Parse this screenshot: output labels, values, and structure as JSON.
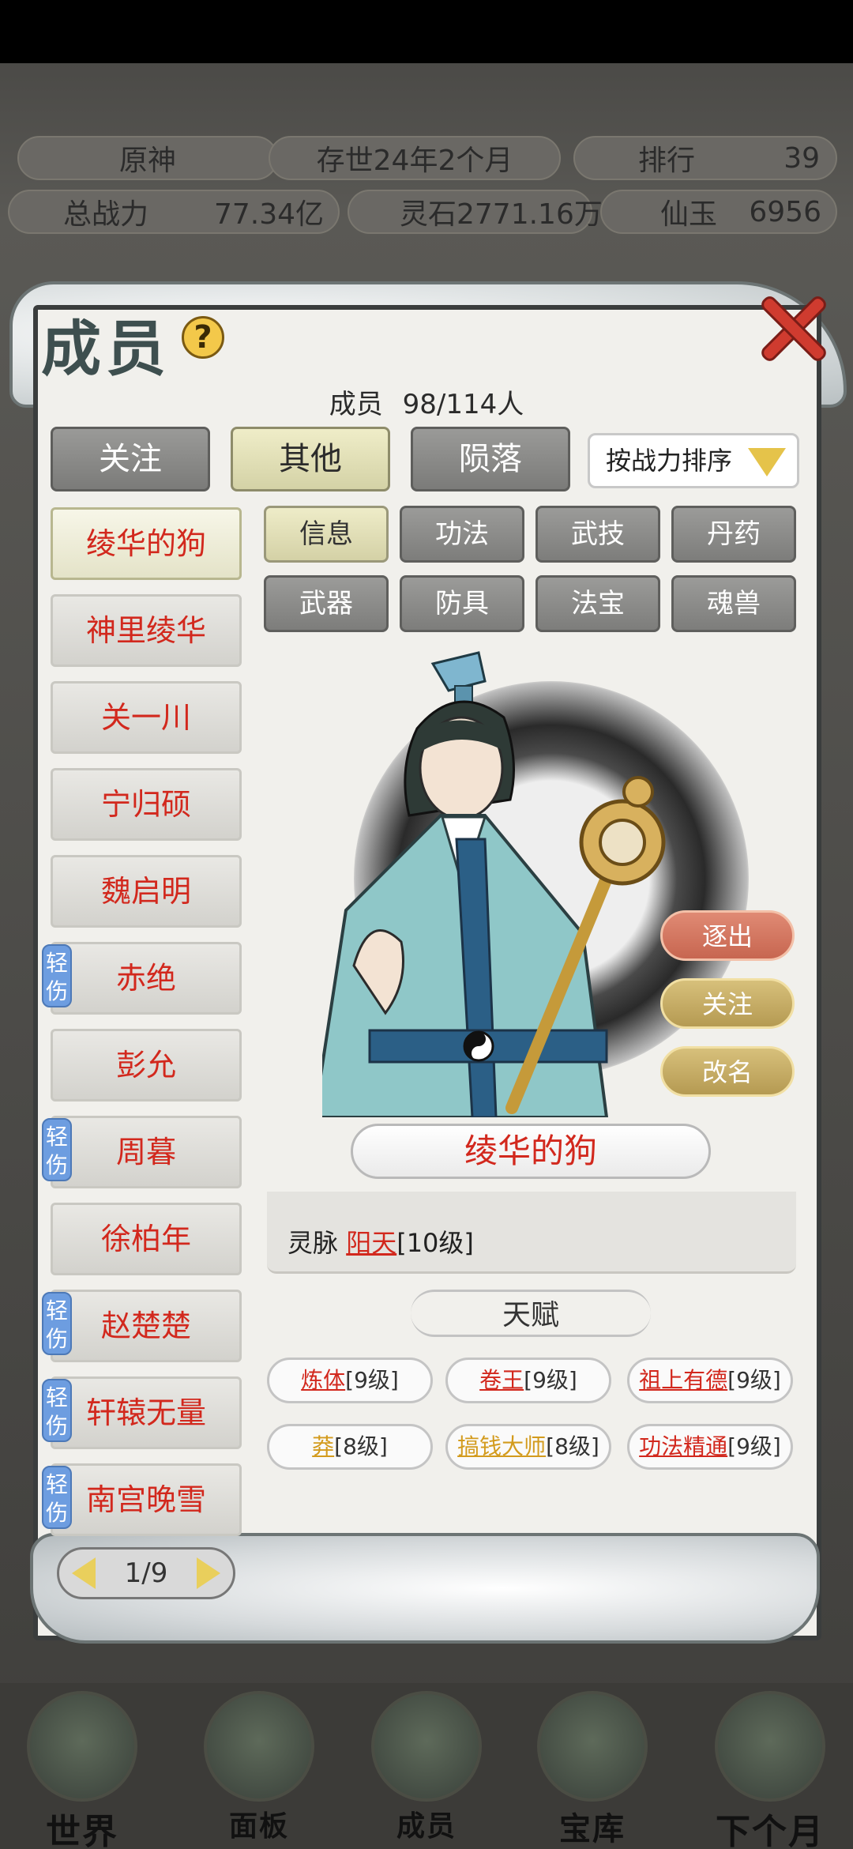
{
  "hud": {
    "server": "原神",
    "age": "存世24年2个月",
    "rank_label": "排行",
    "rank_value": "39",
    "power_label": "总战力",
    "power_value": "77.34亿",
    "spirit_stone": "灵石2771.16万",
    "jade_label": "仙玉",
    "jade_value": "6956"
  },
  "nav": [
    "世界",
    "面板",
    "成员",
    "宝库",
    "下个月"
  ],
  "modal": {
    "title": "成员",
    "count_label": "成员",
    "count_value": "98/114人",
    "tabs": [
      "关注",
      "其他",
      "陨落"
    ],
    "active_tab": 1,
    "sort_label": "按战力排序"
  },
  "members": [
    {
      "name": "绫华的狗",
      "badge": ""
    },
    {
      "name": "神里绫华",
      "badge": ""
    },
    {
      "name": "关一川",
      "badge": ""
    },
    {
      "name": "宁归硕",
      "badge": ""
    },
    {
      "name": "魏启明",
      "badge": ""
    },
    {
      "name": "赤绝",
      "badge": "轻伤"
    },
    {
      "name": "彭允",
      "badge": ""
    },
    {
      "name": "周暮",
      "badge": "轻伤"
    },
    {
      "name": "徐柏年",
      "badge": ""
    },
    {
      "name": "赵楚楚",
      "badge": "轻伤"
    },
    {
      "name": "轩辕无量",
      "badge": "轻伤"
    },
    {
      "name": "南宫晚雪",
      "badge": "轻伤"
    }
  ],
  "pager": "1/9",
  "subtabs": [
    "信息",
    "功法",
    "武技",
    "丹药",
    "武器",
    "防具",
    "法宝",
    "魂兽"
  ],
  "selected": {
    "name": "绫华的狗",
    "actions": [
      "逐出",
      "关注",
      "改名"
    ],
    "vein_label": "灵脉",
    "vein_value": "阳天",
    "vein_level": "[10级]"
  },
  "talent_title": "天赋",
  "talents": [
    {
      "name": "炼体",
      "level": "[9级]",
      "color": "#d2281d"
    },
    {
      "name": "卷王",
      "level": "[9级]",
      "color": "#d2281d"
    },
    {
      "name": "祖上有德",
      "level": "[9级]",
      "color": "#d2281d"
    },
    {
      "name": "莽",
      "level": "[8级]",
      "color": "#d39b1d"
    },
    {
      "name": "搞钱大师",
      "level": "[8级]",
      "color": "#d39b1d"
    },
    {
      "name": "功法精通",
      "level": "[9级]",
      "color": "#d2281d"
    }
  ]
}
